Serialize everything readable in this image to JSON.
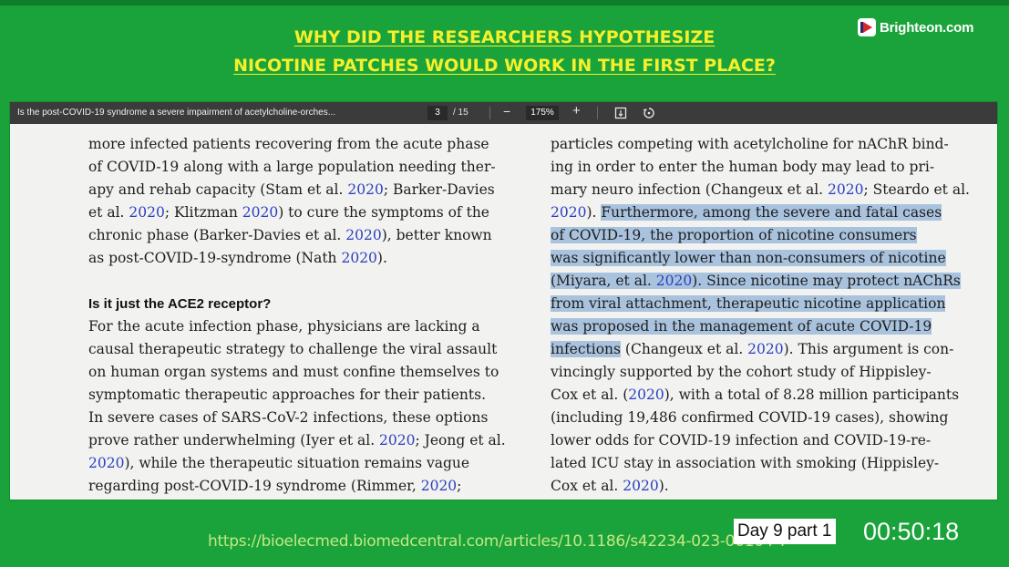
{
  "headline": {
    "line1": "WHY DID THE RESEARCHERS HYPOTHESIZE",
    "line2": "NICOTINE PATCHES WOULD WORK IN THE FIRST PLACE?"
  },
  "logo": {
    "text": "Brighteon.com",
    "icon": "brighteon-play-icon"
  },
  "colors": {
    "background": "#1aa33a",
    "headline": "#f6ef2c",
    "highlight": "#a9c3de",
    "citation": "#2a3fbf",
    "toolbar": "#3b3b3b"
  },
  "toolbar": {
    "doc_title": "Is the post-COVID-19 syndrome a severe impairment of acetylcholine-orches...",
    "page_current": "3",
    "page_total": "/ 15",
    "zoom_minus": "−",
    "zoom_value": "175%",
    "zoom_plus": "+",
    "fit_icon": "fit-page-icon",
    "rotate_icon": "rotate-icon"
  },
  "left_column": {
    "l1": "more infected patients recovering from the acute phase",
    "l2": "of COVID-19 along with a large population needing ther-",
    "l3a": "apy and rehab capacity (Stam et al. ",
    "l3b": "2020",
    "l3c": "; Barker-Davies",
    "l4a": "et al. ",
    "l4b": "2020",
    "l4c": "; Klitzman ",
    "l4d": "2020",
    "l4e": ") to cure the symptoms of the",
    "l5a": "chronic phase (Barker-Davies et al. ",
    "l5b": "2020",
    "l5c": "), better known",
    "l6a": "as post-COVID-19-syndrome (Nath ",
    "l6b": "2020",
    "l6c": ").",
    "heading": "Is it just the ACE2 receptor?",
    "l8": "For the acute infection phase, physicians are lacking a",
    "l9": "causal therapeutic strategy to challenge the viral assault",
    "l10": "on human organ systems and must confine themselves to",
    "l11": "symptomatic therapeutic approaches for their patients.",
    "l12": "In severe cases of SARS-CoV-2 infections, these options",
    "l13a": "prove rather underwhelming (Iyer et al. ",
    "l13b": "2020",
    "l13c": "; Jeong et al.",
    "l14a": "2020",
    "l14b": "), while the therapeutic situation remains vague",
    "l15a": "regarding post-COVID-19 syndrome (Rimmer, ",
    "l15b": "2020",
    "l15c": ";"
  },
  "right_column": {
    "r1": "particles competing with acetylcholine for nAChR bind-",
    "r2": "ing in order to enter the human body may lead to pri-",
    "r3a": "mary neuro infection (Changeux et al. ",
    "r3b": "2020",
    "r3c": "; Steardo et al.",
    "r4a": "2020",
    "r4b": "). ",
    "r4c": "Furthermore, among the severe and fatal cases",
    "r5": "of COVID-19, the proportion of nicotine consumers",
    "r6": "was significantly lower than non-consumers of nicotine",
    "r7a": "(Miyara, et al. ",
    "r7b": "2020",
    "r7c": "). Since nicotine may protect nAChRs",
    "r8": "from viral attachment, therapeutic nicotine application",
    "r9": "was proposed in the management of acute COVID-19",
    "r10a": "infections",
    "r10b": " (Changeux et al. ",
    "r10c": "2020",
    "r10d": "). This argument is con-",
    "r11": "vincingly supported by the cohort study of Hippisley-",
    "r12a": "Cox et al. (",
    "r12b": "2020",
    "r12c": "), with a total of 8.28 million participants",
    "r13": "(including 19,486 confirmed COVID-19 cases), showing",
    "r14": "lower odds for COVID-19 infection and COVID-19-re-",
    "r15": "lated ICU stay in association with smoking (Hippisley-",
    "r16a": "Cox et al. ",
    "r16b": "2020",
    "r16c": ")."
  },
  "footer": {
    "url": "https://bioelecmed.biomedcentral.com/articles/10.1186/s42234-023-00104-7",
    "badge": "Day 9 part 1",
    "timer": "00:50:18"
  }
}
